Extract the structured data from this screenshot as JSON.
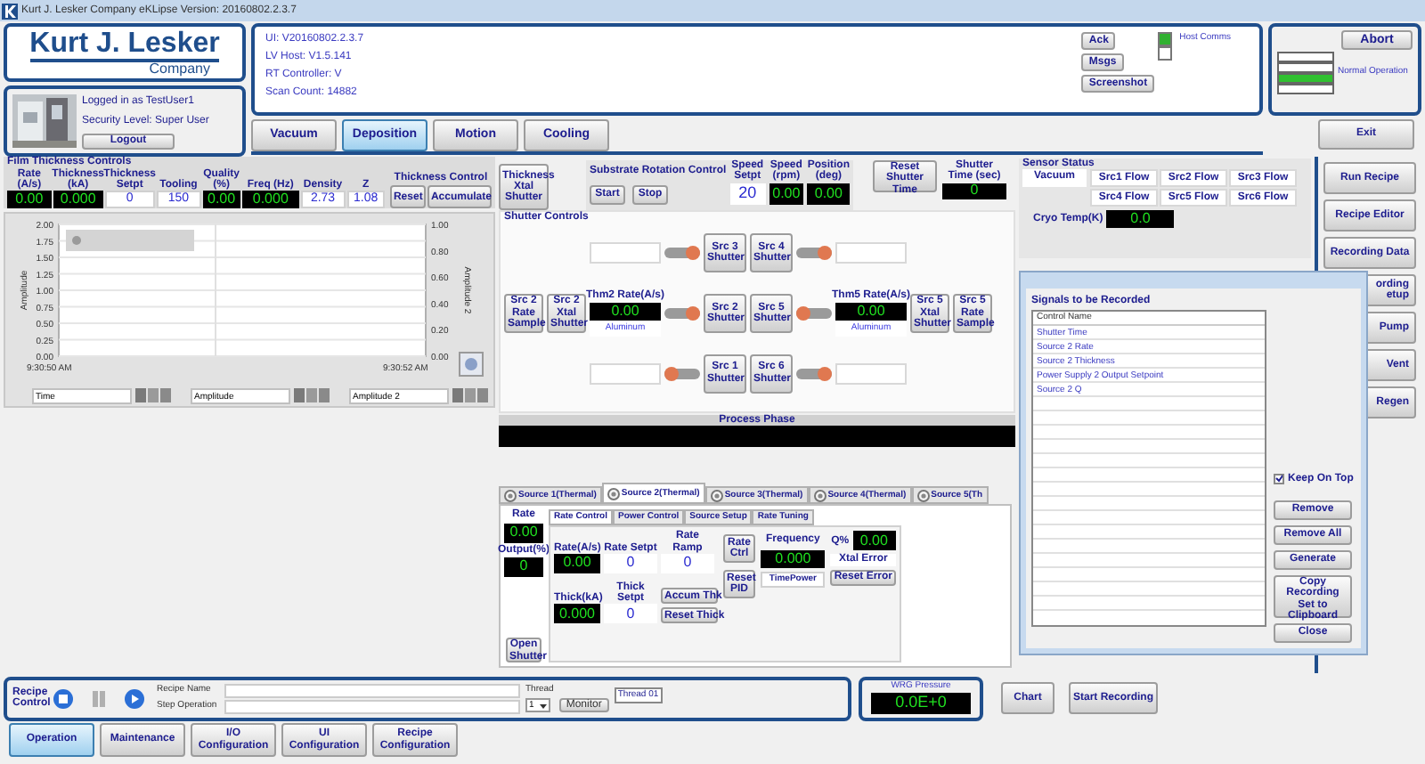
{
  "window": {
    "title": "Kurt J. Lesker Company eKLipse Version: 20160802.2.3.7"
  },
  "logo": {
    "name": "Kurt J. Lesker",
    "subtitle": "Company"
  },
  "user": {
    "logged_in": "Logged in as TestUser1",
    "security": "Security Level: Super User",
    "logout": "Logout"
  },
  "info": {
    "lines": [
      "UI: V20160802.2.3.7",
      "LV Host: V1.5.141",
      "RT Controller: V",
      "Scan Count: 14882"
    ],
    "buttons": [
      "Ack",
      "Msgs",
      "Screenshot"
    ],
    "host_comms": {
      "label": "Host Comms",
      "lights": [
        {
          "on": true
        },
        {
          "on": false
        }
      ]
    }
  },
  "status": {
    "abort": "Abort",
    "bars": [
      {
        "on": false
      },
      {
        "on": false
      },
      {
        "on": true
      },
      {
        "on": false
      }
    ],
    "label": "Normal Operation"
  },
  "main_tabs": [
    {
      "label": "Vacuum",
      "selected": false
    },
    {
      "label": "Deposition",
      "selected": true
    },
    {
      "label": "Motion",
      "selected": false
    },
    {
      "label": "Cooling",
      "selected": false
    }
  ],
  "side_buttons": [
    "Exit",
    "Run Recipe",
    "Recipe Editor",
    "Recording Data",
    "ording etup",
    "Pump",
    "Vent",
    "Regen"
  ],
  "film_thickness": {
    "title": "Film Thickness Controls",
    "columns": [
      {
        "label": "Rate (A/s)",
        "value": "0.00",
        "kind": "display"
      },
      {
        "label": "Thickness (kA)",
        "value": "0.000",
        "kind": "display"
      },
      {
        "label": "Thickness Setpt",
        "value": "0",
        "kind": "input"
      },
      {
        "label": "Tooling",
        "value": "150",
        "kind": "input"
      },
      {
        "label": "Quality (%)",
        "value": "0.00",
        "kind": "display"
      },
      {
        "label": "Freq (Hz)",
        "value": "0.000",
        "kind": "display"
      },
      {
        "label": "Density",
        "value": "2.73",
        "kind": "input"
      },
      {
        "label": "Z",
        "value": "1.08",
        "kind": "input"
      }
    ],
    "control_title": "Thickness Control",
    "buttons": [
      "Reset",
      "Accumulate"
    ]
  },
  "plot": {
    "y_label": "Amplitude",
    "y_ticks": [
      "2.00",
      "1.75",
      "1.50",
      "1.25",
      "1.00",
      "0.75",
      "0.50",
      "0.25",
      "0.00"
    ],
    "right_label": "Amplitude 2",
    "right_ticks": [
      "1.00",
      "0.80",
      "0.60",
      "0.40",
      "0.20",
      "0.00"
    ],
    "x_ticks": [
      "9:30:50 AM",
      "9:30:52 AM"
    ],
    "axis_fields": [
      "Time",
      "Amplitude",
      "Amplitude 2"
    ]
  },
  "xtal_button": "Thickness Xtal Shutter",
  "substrate": {
    "title": "Substrate Rotation Control",
    "buttons": [
      "Start",
      "Stop"
    ],
    "fields": [
      {
        "label": "Speed Setpt",
        "value": "20",
        "kind": "input"
      },
      {
        "label": "Speed (rpm)",
        "value": "0.00",
        "kind": "display"
      },
      {
        "label": "Position (deg)",
        "value": "0.00",
        "kind": "display"
      }
    ]
  },
  "shutter_time": {
    "button": "Reset Shutter Time",
    "label": "Shutter Time (sec)",
    "value": "0"
  },
  "sensor_status": {
    "title": "Sensor Status",
    "vacuum": "Vacuum",
    "flows": [
      "Src1 Flow",
      "Src2 Flow",
      "Src3 Flow",
      "Src4 Flow",
      "Src5 Flow",
      "Src6 Flow"
    ],
    "cryo_label": "Cryo Temp(K)",
    "cryo_value": "0.0"
  },
  "shutter_controls": {
    "title": "Shutter Controls",
    "rows": [
      [
        {
          "kind": "blank"
        },
        {
          "kind": "blank"
        },
        {
          "kind": "field"
        },
        {
          "kind": "bar",
          "knob_right": true
        },
        {
          "kind": "button",
          "label": "Src 3 Shutter"
        },
        {
          "kind": "button",
          "label": "Src 4 Shutter"
        },
        {
          "kind": "bar",
          "knob_right": true
        },
        {
          "kind": "field"
        },
        {
          "kind": "blank"
        },
        {
          "kind": "blank"
        }
      ],
      [
        {
          "kind": "button",
          "label": "Src 2 Rate Sample"
        },
        {
          "kind": "button",
          "label": "Src 2 Xtal Shutter"
        },
        {
          "kind": "rate",
          "label": "Thm2 Rate(A/s)",
          "value": "0.00",
          "material": "Aluminum"
        },
        {
          "kind": "bar",
          "knob_right": true
        },
        {
          "kind": "button",
          "label": "Src 2 Shutter"
        },
        {
          "kind": "button",
          "label": "Src 5 Shutter"
        },
        {
          "kind": "bar",
          "knob_right": false
        },
        {
          "kind": "rate",
          "label": "Thm5 Rate(A/s)",
          "value": "0.00",
          "material": "Aluminum"
        },
        {
          "kind": "button",
          "label": "Src 5 Xtal Shutter"
        },
        {
          "kind": "button",
          "label": "Src 5 Rate Sample"
        }
      ],
      [
        {
          "kind": "blank"
        },
        {
          "kind": "blank"
        },
        {
          "kind": "field"
        },
        {
          "kind": "bar",
          "knob_right": false
        },
        {
          "kind": "button",
          "label": "Src 1 Shutter"
        },
        {
          "kind": "button",
          "label": "Src 6 Shutter"
        },
        {
          "kind": "bar",
          "knob_right": true
        },
        {
          "kind": "field"
        },
        {
          "kind": "blank"
        },
        {
          "kind": "blank"
        }
      ]
    ]
  },
  "process_phase": {
    "title": "Process Phase"
  },
  "source_tabs": [
    {
      "label": "Source 1(Thermal)",
      "selected": false
    },
    {
      "label": "Source 2(Thermal)",
      "selected": true
    },
    {
      "label": "Source 3(Thermal)",
      "selected": false
    },
    {
      "label": "Source 4(Thermal)",
      "selected": false
    },
    {
      "label": "Source 5(Th",
      "selected": false
    }
  ],
  "source_panel": {
    "rate_label": "Rate",
    "rate": "0.00",
    "output_label": "Output(%)",
    "output": "0",
    "open_shutter": "Open Shutter",
    "sub_tabs": [
      {
        "label": "Rate Control",
        "selected": true
      },
      {
        "label": "Power Control",
        "selected": false
      },
      {
        "label": "Source Setup",
        "selected": false
      },
      {
        "label": "Rate Tuning",
        "selected": false
      }
    ],
    "rate_as_label": "Rate(A/s)",
    "rate_as": "0.00",
    "rate_setpt_label": "Rate Setpt",
    "rate_setpt": "0",
    "rate_ramp_label": "Rate Ramp",
    "rate_ramp": "0",
    "rate_ctrl": "Rate Ctrl",
    "frequency_label": "Frequency",
    "frequency": "0.000",
    "q_label": "Q%",
    "q": "0.00",
    "xtal_error": "Xtal Error",
    "thick_label": "Thick(kA)",
    "thick": "0.000",
    "thick_setpt_label": "Thick Setpt",
    "thick_setpt": "0",
    "accum_thk": "Accum Thk",
    "reset_thick": "Reset Thick",
    "reset_pid": "Reset PID",
    "time_power": "TimePower",
    "reset_error": "Reset Error"
  },
  "dialog": {
    "heading": "Signals to be Recorded",
    "column": "Control Name",
    "rows": [
      "Shutter Time",
      "Source 2 Rate",
      "Source 2 Thickness",
      "Power Supply 2 Output Setpoint",
      "Source 2 Q"
    ],
    "keep_on_top": {
      "label": "Keep On Top",
      "checked": true
    },
    "buttons": [
      "Remove",
      "Remove All",
      "Generate",
      "Copy Recording Set to Clipboard",
      "Close"
    ]
  },
  "recipe": {
    "label": "Recipe Control",
    "name_label": "Recipe Name",
    "step_label": "Step Operation",
    "thread_label": "Thread",
    "thread_value": "1",
    "monitor": "Monitor",
    "thread_tag": "Thread 01"
  },
  "wrg": {
    "label": "WRG Pressure",
    "value": "0.0E+0"
  },
  "bottom_buttons": [
    "Chart",
    "Start Recording"
  ],
  "bottom_tabs": [
    {
      "label": "Operation",
      "selected": true
    },
    {
      "label": "Maintenance",
      "selected": false
    },
    {
      "label": "I/O Configuration",
      "selected": false
    },
    {
      "label": "UI Configuration",
      "selected": false
    },
    {
      "label": "Recipe Configuration",
      "selected": false
    }
  ]
}
